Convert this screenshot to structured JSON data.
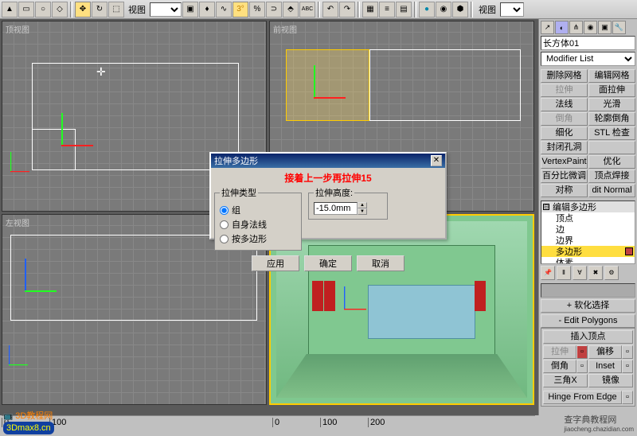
{
  "toolbar": {
    "view_label": "视图",
    "right_view_label": "视图"
  },
  "viewports": {
    "top": "顶视图",
    "front": "前视图",
    "left": "左视图",
    "persp": ""
  },
  "dialog": {
    "title": "拉伸多边形",
    "red_text": "接着上一步再拉伸15",
    "group_extrude_type": "拉伸类型",
    "radio_group": "组",
    "radio_local": "自身法线",
    "radio_bypoly": "按多边形",
    "group_height": "拉伸高度:",
    "height_value": "-15.0mm",
    "btn_apply": "应用",
    "btn_ok": "确定",
    "btn_cancel": "取消"
  },
  "panel": {
    "object_name": "长方体01",
    "modifier_list": "Modifier List",
    "buttons": {
      "delete_mesh": "删除网格",
      "edit_mesh": "编辑网格",
      "extrude": "拉伸",
      "face_extrude": "面拉伸",
      "normal": "法线",
      "smooth": "光滑",
      "fillet": "倒角",
      "chamfer": "轮廓倒角",
      "refine": "细化",
      "stl_check": "STL 检查",
      "cap_holes": "封闭孔洞",
      "blank1": "",
      "vertexpaint": "VertexPaint",
      "optimize": "优化",
      "percent": "百分比微调",
      "weld_vertex": "顶点焊接",
      "symmetry": "对称",
      "dit_normal": "dit Normal"
    },
    "stack": {
      "edit_poly": "编辑多边形",
      "vertex": "顶点",
      "edge": "边",
      "border": "边界",
      "polygon": "多边形",
      "element": "体素"
    },
    "rollouts": {
      "soft_sel": "软化选择",
      "edit_polys": "Edit Polygons",
      "insert_vert": "插入顶点",
      "r1a": "拉伸",
      "r1b": "偏移",
      "r2a": "倒角",
      "r2b": "Inset",
      "r3a": "三角X",
      "r3b": "镜像",
      "hinge": "Hinge From Edge"
    }
  },
  "ruler": {
    "marks": [
      "0",
      "100",
      "0",
      "100",
      "200"
    ]
  },
  "branding": {
    "logo_top": "3D教程网",
    "logo_bottom": "3Dmax8.cn",
    "site": "查字典教程网",
    "site_url": "jiaocheng.chazidian.com"
  }
}
